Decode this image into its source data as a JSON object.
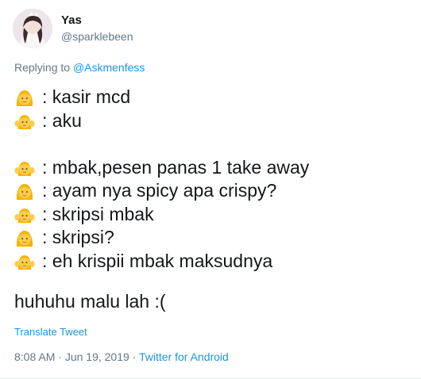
{
  "user": {
    "display_name": "Yas",
    "handle": "@sparklebeen"
  },
  "reply": {
    "prefix": "Replying to ",
    "mention": "@Askmenfess"
  },
  "tweet": {
    "lines": [
      ": kasir mcd",
      ": aku",
      "",
      ": mbak,pesen panas 1 take away",
      ": ayam nya spicy apa crispy?",
      ": skripsi mbak",
      ": skripsi?",
      ": eh krispii mbak maksudnya"
    ],
    "closing": "huhuhu malu lah :("
  },
  "translate_label": "Translate Tweet",
  "meta": {
    "time": "8:08 AM",
    "separator1": " · ",
    "date": "Jun 19, 2019",
    "separator2": " · ",
    "source": "Twitter for Android"
  },
  "icons": {
    "avatar": "profile-photo",
    "line_emoji_a": "woman-emoji",
    "line_emoji_b": "woman-raising-hands-emoji"
  }
}
